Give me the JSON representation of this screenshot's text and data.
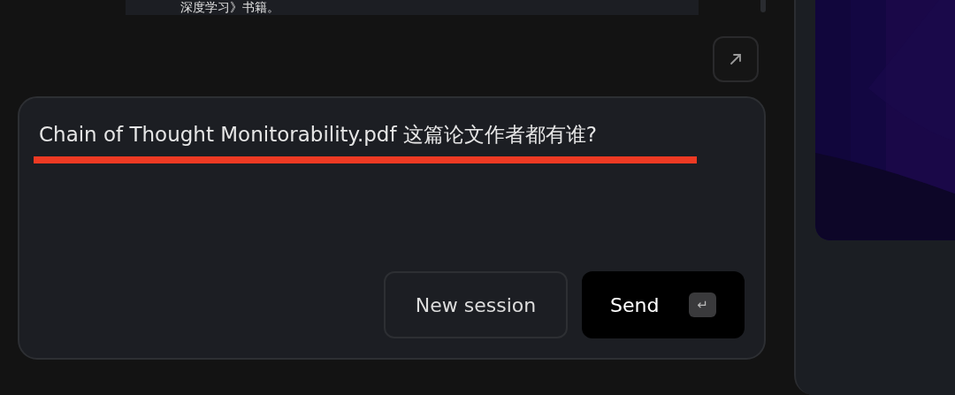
{
  "previous_message": {
    "text": "深度学习》书籍。"
  },
  "input": {
    "value": "Chain of Thought Monitorability.pdf 这篇论文作者都有谁?",
    "annotated": true
  },
  "buttons": [
    {
      "kind": "secondary",
      "label": "New session"
    },
    {
      "kind": "primary",
      "label": "Send",
      "shortcut": "↵"
    }
  ]
}
